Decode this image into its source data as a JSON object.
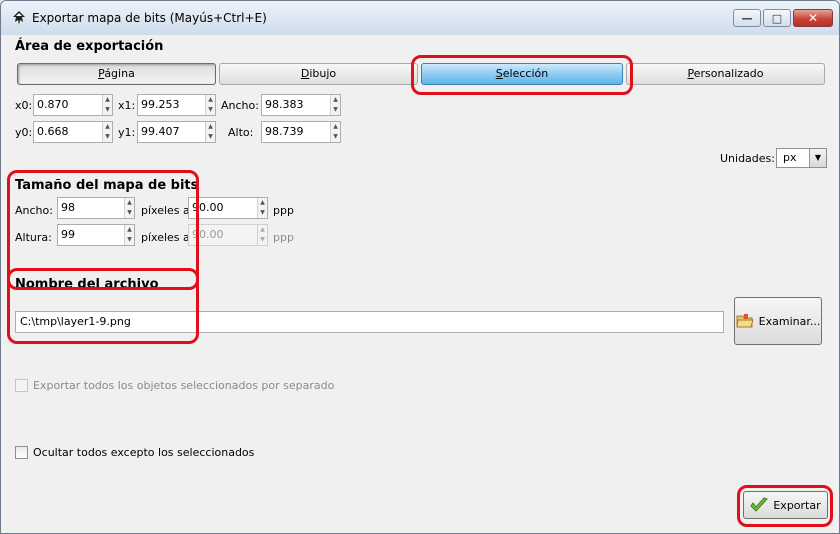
{
  "window": {
    "title": "Exportar mapa de bits (Mayús+Ctrl+E)"
  },
  "export_area": {
    "heading": "Área de exportación",
    "tabs": [
      {
        "label": "Página",
        "underline": "P",
        "rest": "ágina",
        "state": "pressed"
      },
      {
        "label": "Dibujo",
        "underline": "D",
        "rest": "ibujo",
        "state": "normal"
      },
      {
        "label": "Selección",
        "underline": "S",
        "rest": "elección",
        "state": "active"
      },
      {
        "label": "Personalizado",
        "underline": "P",
        "rest": "ersonalizado",
        "state": "normal"
      }
    ],
    "x0_label": "x0:",
    "x0": "0.870",
    "y0_label": "y0:",
    "y0": "0.668",
    "x1_label": "x1:",
    "x1": "99.253",
    "y1_label": "y1:",
    "y1": "99.407",
    "width_label": "Ancho:",
    "width": "98.383",
    "height_label": "Alto:",
    "height": "98.739",
    "units_label": "Unidades:",
    "units": "px"
  },
  "bitmap_size": {
    "heading": "Tamaño del mapa de bits",
    "width_label": "Ancho:",
    "width": "98",
    "width_dpi_label": "píxeles a",
    "width_dpi": "90.00",
    "width_unit": "ppp",
    "height_label": "Altura:",
    "height": "99",
    "height_dpi_label": "píxeles a",
    "height_dpi": "90.00",
    "height_unit": "ppp"
  },
  "filename": {
    "heading": "Nombre del archivo",
    "value": "C:\\tmp\\layer1-9.png",
    "browse_label": "Examinar..."
  },
  "options": {
    "batch_export": {
      "label": "Exportar todos los objetos seleccionados por separado",
      "checked": false,
      "enabled": false
    },
    "hide_all_except_selected": {
      "label": "Ocultar todos excepto los seleccionados",
      "checked": false,
      "enabled": true
    }
  },
  "export_button": {
    "label": "Exportar"
  },
  "colors": {
    "highlight": "#e0101a",
    "active_tab": "#5fb4e8"
  }
}
